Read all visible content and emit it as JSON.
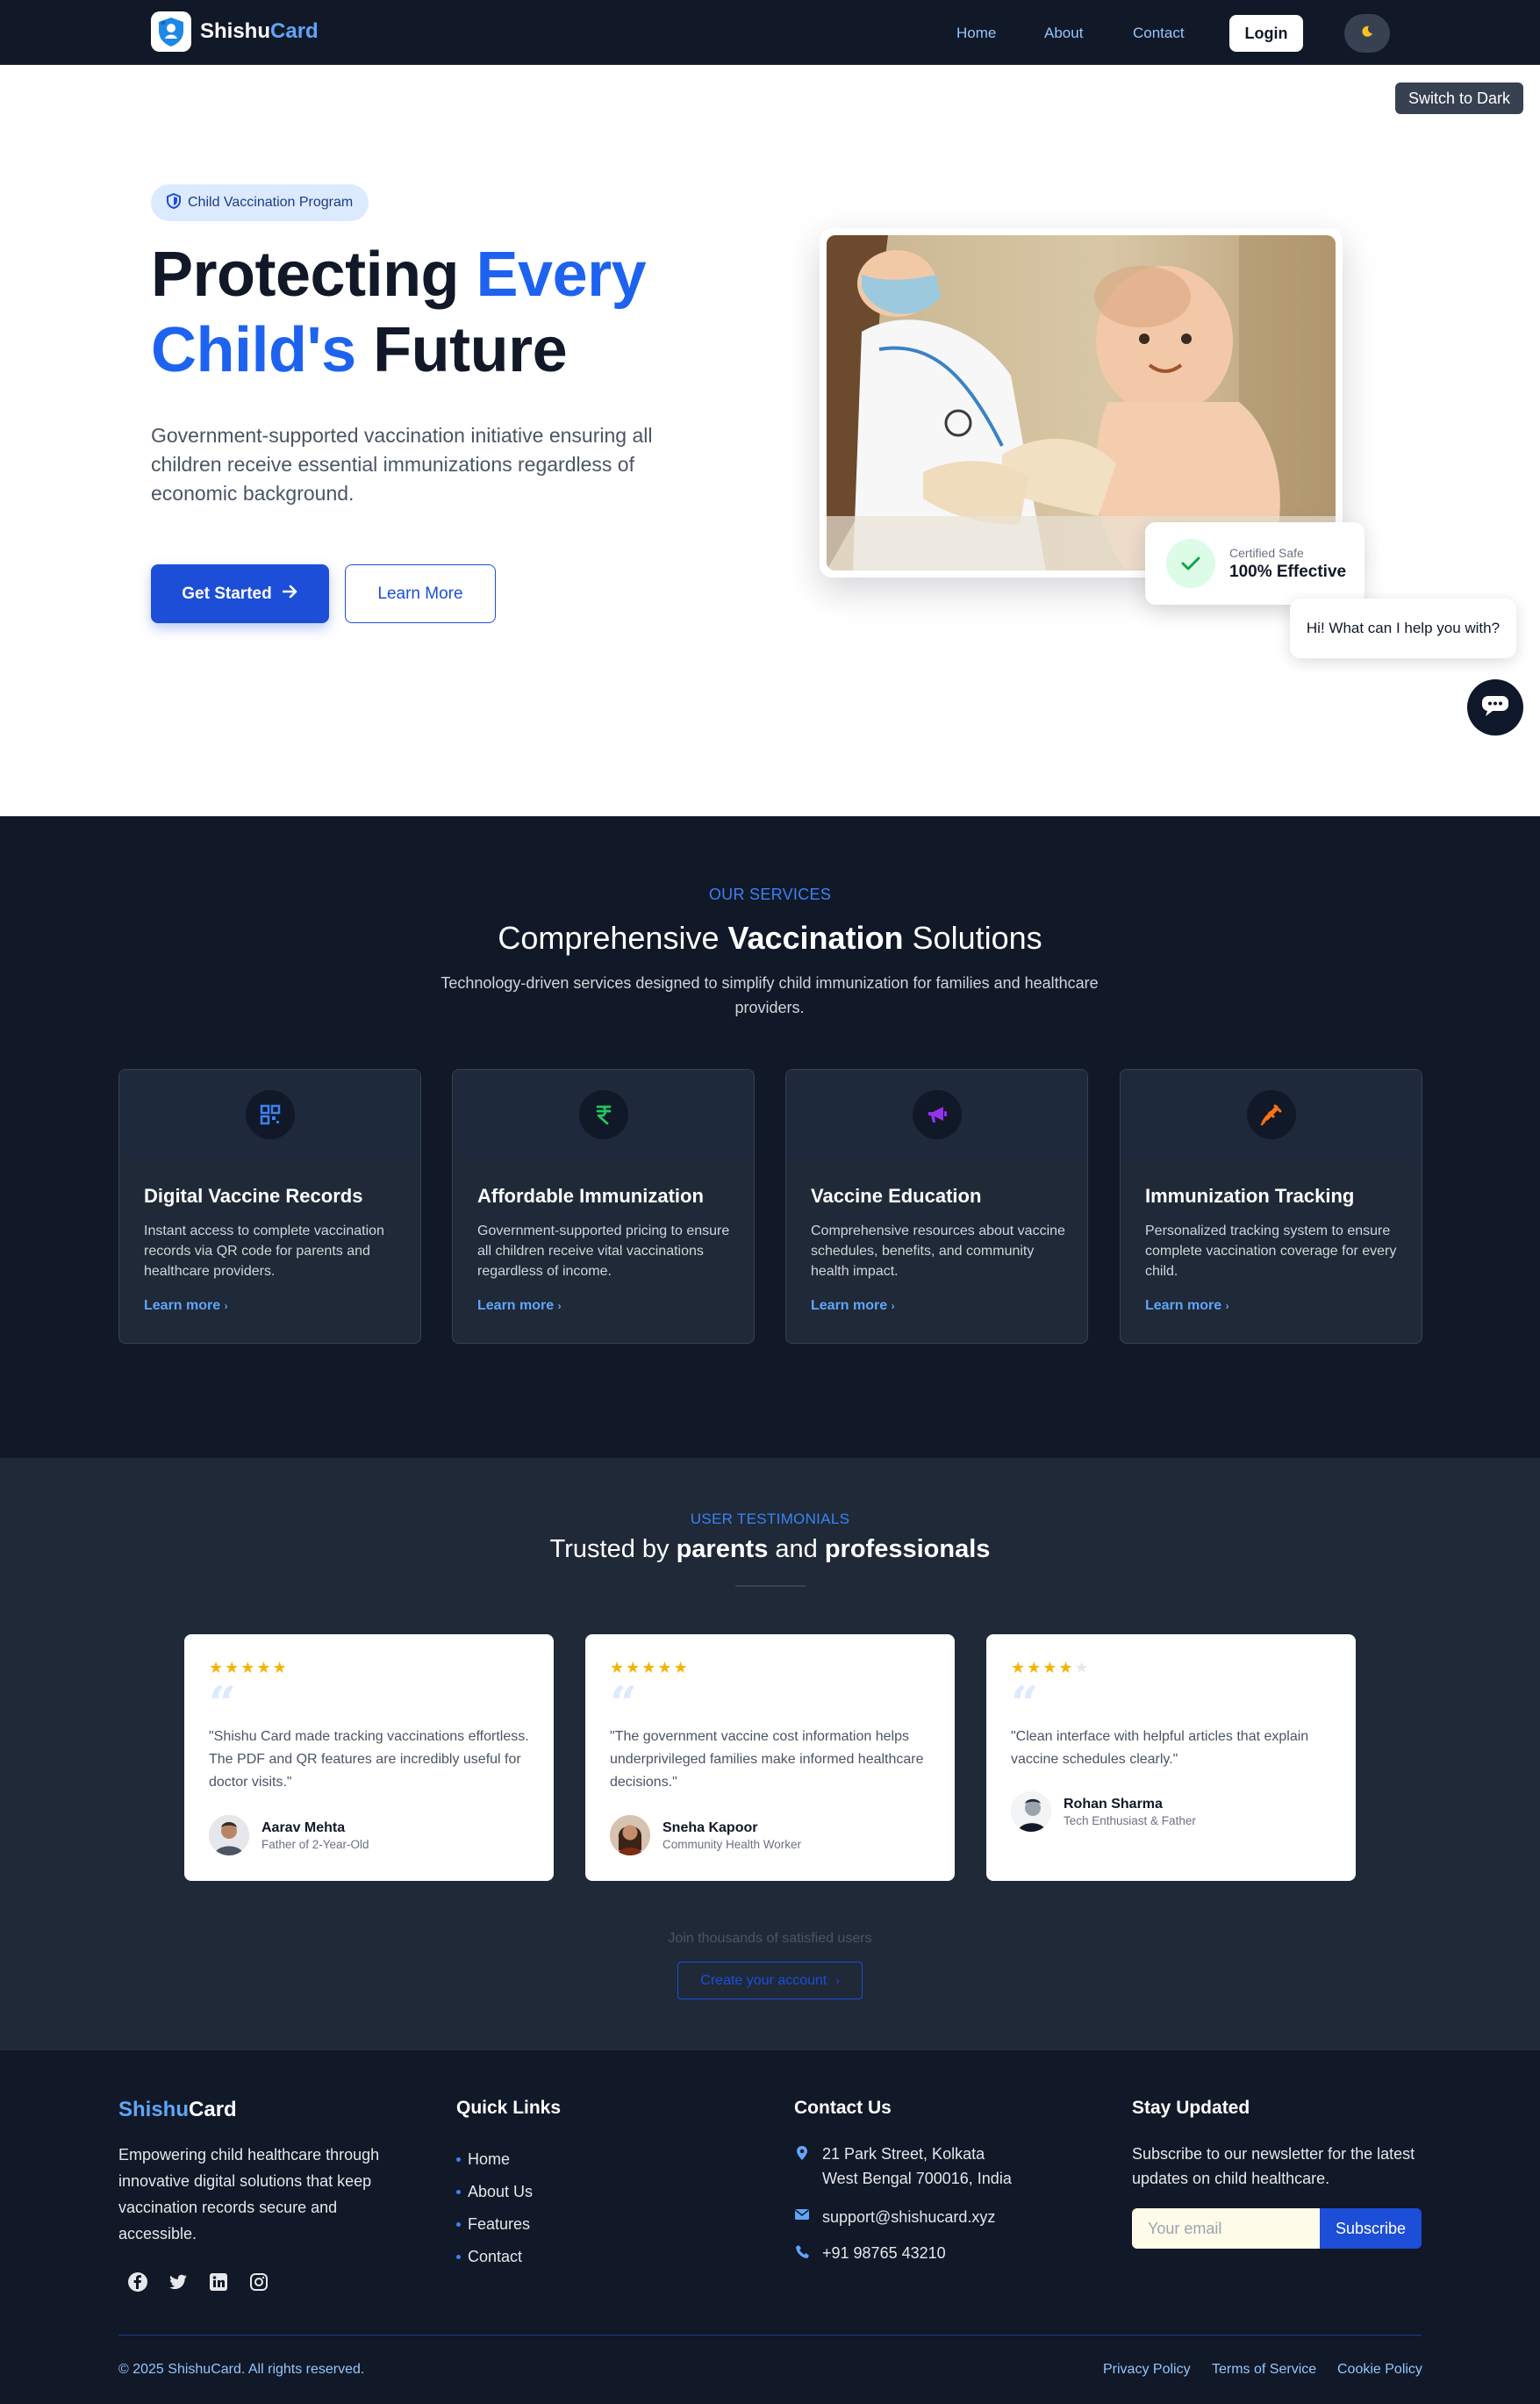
{
  "nav": {
    "brand_part1": "Shishu",
    "brand_part2": "Card",
    "links": [
      "Home",
      "About",
      "Contact"
    ],
    "login_label": "Login",
    "theme_icon": "moon-icon"
  },
  "theme_toggle_label": "Switch to Dark",
  "hero": {
    "pill_label": "Child Vaccination Program",
    "title_part1": "Protecting ",
    "title_part2": "Every",
    "title_part3": "Child's",
    "title_part4": " Future",
    "subtitle": "Government-supported vaccination initiative ensuring all children receive essential immunizations regardless of economic background.",
    "primary_cta": "Get Started",
    "secondary_cta": "Learn More",
    "badge_small": "Certified Safe",
    "badge_big": "100% Effective"
  },
  "chat": {
    "greeting": "Hi! What can I help you with?"
  },
  "services": {
    "eyebrow": "OUR SERVICES",
    "title_light1": "Comprehensive ",
    "title_bold": "Vaccination",
    "title_light2": " Solutions",
    "subtitle": "Technology-driven services designed to simplify child immunization for families and healthcare providers.",
    "cards": [
      {
        "icon": "qr-code-icon",
        "icon_color": "#3b82f6",
        "title": "Digital Vaccine Records",
        "desc": "Instant access to complete vaccination records via QR code for parents and healthcare providers.",
        "link": "Learn more"
      },
      {
        "icon": "rupee-icon",
        "icon_color": "#22c55e",
        "title": "Affordable Immunization",
        "desc": "Government-supported pricing to ensure all children receive vital vaccinations regardless of income.",
        "link": "Learn more"
      },
      {
        "icon": "megaphone-icon",
        "icon_color": "#9333ea",
        "title": "Vaccine Education",
        "desc": "Comprehensive resources about vaccine schedules, benefits, and community health impact.",
        "link": "Learn more"
      },
      {
        "icon": "syringe-icon",
        "icon_color": "#f97316",
        "title": "Immunization Tracking",
        "desc": "Personalized tracking system to ensure complete vaccination coverage for every child.",
        "link": "Learn more"
      }
    ]
  },
  "testimonials": {
    "eyebrow": "USER TESTIMONIALS",
    "title_1": "Trusted by ",
    "title_2": "parents",
    "title_3": " and ",
    "title_4": "professionals",
    "items": [
      {
        "rating": 5,
        "text": "\"Shishu Card made tracking vaccinations effortless. The PDF and QR features are incredibly useful for doctor visits.\"",
        "name": "Aarav Mehta",
        "role": "Father of 2-Year-Old"
      },
      {
        "rating": 5,
        "text": "\"The government vaccine cost information helps underprivileged families make informed healthcare decisions.\"",
        "name": "Sneha Kapoor",
        "role": "Community Health Worker"
      },
      {
        "rating": 4,
        "text": "\"Clean interface with helpful articles that explain vaccine schedules clearly.\"",
        "name": "Rohan Sharma",
        "role": "Tech Enthusiast & Father"
      }
    ],
    "join_text": "Join thousands of satisfied users",
    "create_cta": "Create your account"
  },
  "footer": {
    "brand_part1": "Shishu",
    "brand_part2": "Card",
    "about": "Empowering child healthcare through innovative digital solutions that keep vaccination records secure and accessible.",
    "social_icons": [
      "facebook-icon",
      "twitter-icon",
      "linkedin-icon",
      "instagram-icon"
    ],
    "quick_links_heading": "Quick Links",
    "quick_links": [
      "Home",
      "About Us",
      "Features",
      "Contact"
    ],
    "contact_heading": "Contact Us",
    "address_line1": "21 Park Street, Kolkata",
    "address_line2": "West Bengal 700016, India",
    "email": "support@shishucard.xyz",
    "phone": "+91 98765 43210",
    "newsletter_heading": "Stay Updated",
    "newsletter_text": "Subscribe to our newsletter for the latest updates on child healthcare.",
    "email_placeholder": "Your email",
    "subscribe_label": "Subscribe",
    "copyright": "© 2025 ShishuCard. All rights reserved.",
    "legal_links": [
      "Privacy Policy",
      "Terms of Service",
      "Cookie Policy"
    ]
  },
  "colors": {
    "accent": "#1d4ed8",
    "dark_bg": "#111827",
    "card_bg": "#1f2937",
    "star": "#f5b301"
  }
}
